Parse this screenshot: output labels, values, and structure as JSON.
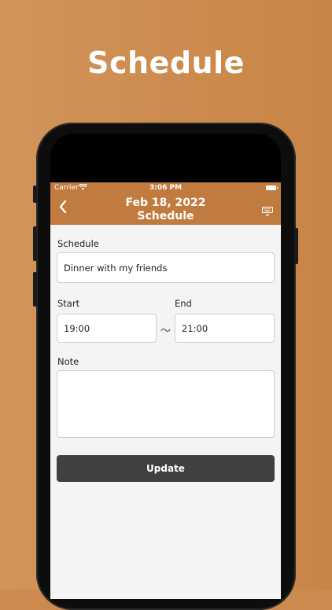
{
  "headline": "Schedule",
  "status_bar": {
    "carrier": "Carrier",
    "time": "3:06 PM"
  },
  "nav": {
    "date": "Feb 18, 2022",
    "title": "Schedule"
  },
  "form": {
    "schedule_label": "Schedule",
    "schedule_value": "Dinner with my friends",
    "start_label": "Start",
    "start_value": "19:00",
    "separator": "～",
    "end_label": "End",
    "end_value": "21:00",
    "note_label": "Note",
    "note_value": "",
    "update_label": "Update"
  },
  "colors": {
    "background": "#cd8a4e",
    "nav_bar": "#c27b3f",
    "update_button": "#404040",
    "screen_background": "#f4f4f4"
  },
  "icons": {
    "back": "chevron-left-icon",
    "keyboard": "keyboard-hide-icon",
    "wifi": "wifi-icon",
    "battery": "battery-icon"
  }
}
